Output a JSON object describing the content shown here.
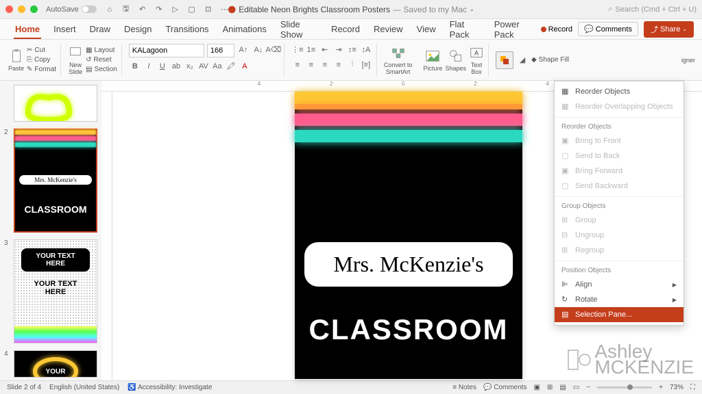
{
  "titlebar": {
    "autosave": "AutoSave",
    "document_name": "Editable Neon Brights Classroom Posters",
    "save_status": "— Saved to my Mac",
    "search_placeholder": "Search (Cmd + Ctrl + U)"
  },
  "menu": {
    "tabs": [
      "Home",
      "Insert",
      "Draw",
      "Design",
      "Transitions",
      "Animations",
      "Slide Show",
      "Record",
      "Review",
      "View",
      "Flat Pack",
      "Power Pack"
    ],
    "active": "Home",
    "record": "Record",
    "comments": "Comments",
    "share": "Share"
  },
  "ribbon": {
    "paste": "Paste",
    "cut": "Cut",
    "copy": "Copy",
    "format": "Format",
    "new_slide": "New\nSlide",
    "layout": "Layout",
    "reset": "Reset",
    "section": "Section",
    "font_name": "KALagoon",
    "font_size": "166",
    "convert": "Convert to\nSmartArt",
    "picture": "Picture",
    "shapes": "Shapes",
    "text_box": "Text\nBox",
    "shape_fill": "Shape Fill",
    "designer": "igner"
  },
  "slides": {
    "items": [
      {
        "num": "",
        "type": "heart"
      },
      {
        "num": "2",
        "type": "classroom",
        "title": "Mrs. McKenzie's",
        "subtitle": "CLASSROOM"
      },
      {
        "num": "3",
        "type": "text",
        "line1": "YOUR TEXT\nHERE",
        "line2": "YOUR TEXT\nHERE"
      },
      {
        "num": "4",
        "type": "heart2",
        "text": "YOUR"
      }
    ]
  },
  "canvas": {
    "title": "Mrs. McKenzie's",
    "subtitle": "CLASSROOM"
  },
  "context_menu": {
    "reorder_objects": "Reorder Objects",
    "reorder_overlapping": "Reorder Overlapping Objects",
    "section_reorder": "Reorder Objects",
    "bring_front": "Bring to Front",
    "send_back": "Send to Back",
    "bring_forward": "Bring Forward",
    "send_backward": "Send Backward",
    "section_group": "Group Objects",
    "group": "Group",
    "ungroup": "Ungroup",
    "regroup": "Regroup",
    "section_position": "Position Objects",
    "align": "Align",
    "rotate": "Rotate",
    "selection_pane": "Selection Pane..."
  },
  "statusbar": {
    "slide": "Slide 2 of 4",
    "language": "English (United States)",
    "accessibility": "Accessibility: Investigate",
    "notes": "Notes",
    "comments": "Comments",
    "zoom": "73%"
  },
  "watermark": "Ashley\nMCKENZIE",
  "colors": {
    "neon_yellow": "#ffc834",
    "neon_pink": "#ff5b8c",
    "neon_teal": "#2bd9c0",
    "orange_accent": "#c43e1c"
  },
  "ruler_marks": [
    "4",
    "2",
    "0",
    "2",
    "4"
  ]
}
